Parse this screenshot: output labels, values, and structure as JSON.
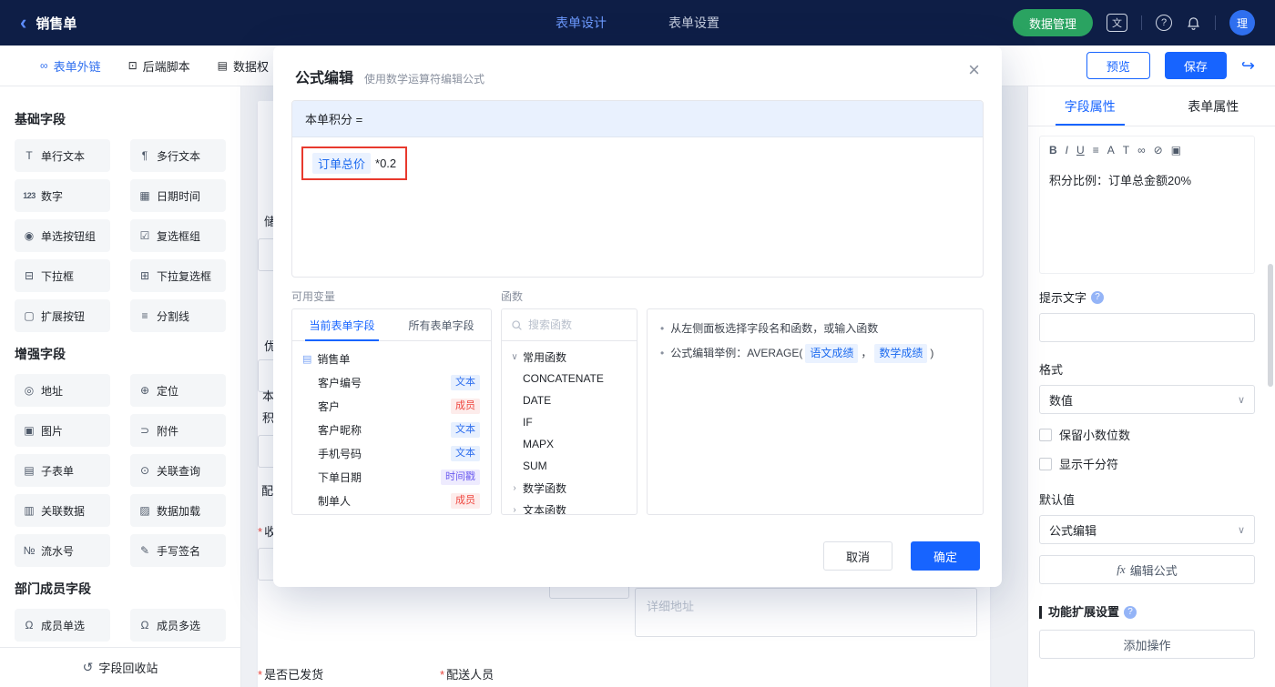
{
  "colors": {
    "accent_blue": "#1764ff",
    "topbar_navy": "#0e1e46",
    "green_button": "#2aa361",
    "annotation_red": "#e8392d",
    "tag_text_blue": "#2f6fef",
    "tag_member_red": "#ef4840",
    "tag_timestamp_purple": "#6c5bf0"
  },
  "ui": {
    "back_icon": "‹",
    "close_icon": "×",
    "chevron_down": "∨",
    "chevron_right": "›",
    "bullet": "•"
  },
  "topbar": {
    "title": "销售单",
    "tabs": [
      {
        "label": "表单设计"
      },
      {
        "label": "表单设置"
      }
    ],
    "data_manage": "数据管理",
    "lang_icon_text": "文",
    "help_icon_text": "?",
    "avatar_text": "理"
  },
  "toolbar": {
    "items": [
      {
        "icon": "∞",
        "label": "表单外链"
      },
      {
        "icon": "⊡",
        "label": "后端脚本"
      },
      {
        "icon": "▤",
        "label": "数据权"
      }
    ],
    "preview": "预览",
    "save": "保存",
    "share_icon": "↪"
  },
  "sidebar": {
    "sections": [
      {
        "title": "基础字段",
        "items": [
          {
            "icon": "T",
            "label": "单行文本"
          },
          {
            "icon": "¶",
            "label": "多行文本"
          },
          {
            "icon": "123",
            "label": "数字"
          },
          {
            "icon": "▦",
            "label": "日期时间"
          },
          {
            "icon": "◉",
            "label": "单选按钮组"
          },
          {
            "icon": "☑",
            "label": "复选框组"
          },
          {
            "icon": "⊟",
            "label": "下拉框"
          },
          {
            "icon": "⊞",
            "label": "下拉复选框"
          },
          {
            "icon": "▢",
            "label": "扩展按钮"
          },
          {
            "icon": "≡",
            "label": "分割线"
          }
        ]
      },
      {
        "title": "增强字段",
        "items": [
          {
            "icon": "◎",
            "label": "地址"
          },
          {
            "icon": "⊕",
            "label": "定位"
          },
          {
            "icon": "▣",
            "label": "图片"
          },
          {
            "icon": "⊃",
            "label": "附件"
          },
          {
            "icon": "▤",
            "label": "子表单"
          },
          {
            "icon": "⊙",
            "label": "关联查询"
          },
          {
            "icon": "▥",
            "label": "关联数据"
          },
          {
            "icon": "▨",
            "label": "数据加载"
          },
          {
            "icon": "№",
            "label": "流水号"
          },
          {
            "icon": "✎",
            "label": "手写签名"
          }
        ]
      },
      {
        "title": "部门成员字段",
        "items": [
          {
            "icon": "Ω",
            "label": "成员单选"
          },
          {
            "icon": "Ω",
            "label": "成员多选"
          }
        ]
      }
    ],
    "recycle": {
      "icon": "↺",
      "label": "字段回收站"
    }
  },
  "canvas": {
    "fragments": {
      "f1": "储",
      "f2": "优",
      "f3": "本",
      "f4": "积",
      "f5": "配",
      "f6": "收"
    },
    "required_mark": "*",
    "detail_address_placeholder": "详细地址",
    "shipped_label": "是否已发货",
    "delivery_label": "配送人员"
  },
  "modal": {
    "title": "公式编辑",
    "subtitle": "使用数学运算符编辑公式",
    "formula": {
      "header": "本单积分 =",
      "variable": "订单总价",
      "expression": "*0.2"
    },
    "variables": {
      "title": "可用变量",
      "tabs": [
        "当前表单字段",
        "所有表单字段"
      ],
      "form_icon": "▤",
      "form_name": "销售单",
      "fields": [
        {
          "name": "客户编号",
          "type": "文本"
        },
        {
          "name": "客户",
          "type": "成员"
        },
        {
          "name": "客户昵称",
          "type": "文本"
        },
        {
          "name": "手机号码",
          "type": "文本"
        },
        {
          "name": "下单日期",
          "type": "时间戳"
        },
        {
          "name": "制单人",
          "type": "成员"
        }
      ]
    },
    "functions": {
      "title": "函数",
      "search_placeholder": "搜索函数",
      "groups": [
        {
          "name": "常用函数",
          "items": [
            "CONCATENATE",
            "DATE",
            "IF",
            "MAPX",
            "SUM"
          ]
        },
        {
          "name": "数学函数"
        },
        {
          "name": "文本函数"
        }
      ]
    },
    "help": {
      "line1": "从左侧面板选择字段名和函数，或输入函数",
      "line2_prefix": "公式编辑举例：AVERAGE(",
      "chip1": "语文成绩",
      "separator": "，",
      "chip2": "数学成绩",
      "line2_suffix": ")"
    },
    "cancel": "取消",
    "confirm": "确定"
  },
  "props": {
    "tabs": [
      "字段属性",
      "表单属性"
    ],
    "editor_icons": {
      "bold": "B",
      "italic": "I",
      "underline": "U",
      "align": "≡",
      "color": "A",
      "font": "T",
      "link": "∞",
      "unlink": "⊘",
      "image": "▣"
    },
    "description": "积分比例：订单总金额20%",
    "hint_label": "提示文字",
    "format_label": "格式",
    "format_value": "数值",
    "decimal_checkbox": "保留小数位数",
    "thousands_checkbox": "显示千分符",
    "default_label": "默认值",
    "default_value": "公式编辑",
    "fx": "fx",
    "edit_formula": "编辑公式",
    "extension_label": "功能扩展设置",
    "add_action": "添加操作",
    "question_badge": "?"
  }
}
